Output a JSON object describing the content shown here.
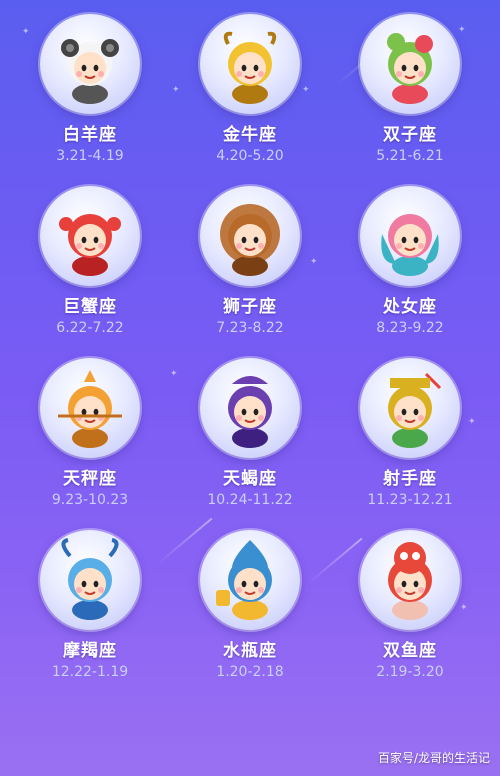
{
  "signs": [
    {
      "key": "aries",
      "name": "白羊座",
      "dates": "3.21-4.19",
      "icon": "aries-mascot-icon",
      "color": "#f5f5f5",
      "accent": "#555555"
    },
    {
      "key": "taurus",
      "name": "金牛座",
      "dates": "4.20-5.20",
      "icon": "taurus-mascot-icon",
      "color": "#f2c230",
      "accent": "#b07a10"
    },
    {
      "key": "gemini",
      "name": "双子座",
      "dates": "5.21-6.21",
      "icon": "gemini-mascot-icon",
      "color": "#7cc24a",
      "accent": "#e84a5a"
    },
    {
      "key": "cancer",
      "name": "巨蟹座",
      "dates": "6.22-7.22",
      "icon": "cancer-mascot-icon",
      "color": "#e8403a",
      "accent": "#b82222"
    },
    {
      "key": "leo",
      "name": "狮子座",
      "dates": "7.23-8.22",
      "icon": "leo-mascot-icon",
      "color": "#b86a2a",
      "accent": "#7a3f12"
    },
    {
      "key": "virgo",
      "name": "处女座",
      "dates": "8.23-9.22",
      "icon": "virgo-mascot-icon",
      "color": "#f07aa0",
      "accent": "#3bb3c4"
    },
    {
      "key": "libra",
      "name": "天秤座",
      "dates": "9.23-10.23",
      "icon": "libra-mascot-icon",
      "color": "#f3a133",
      "accent": "#c0701a"
    },
    {
      "key": "scorpio",
      "name": "天蝎座",
      "dates": "10.24-11.22",
      "icon": "scorpio-mascot-icon",
      "color": "#6a3fb0",
      "accent": "#3d2080"
    },
    {
      "key": "sagittarius",
      "name": "射手座",
      "dates": "11.23-12.21",
      "icon": "sagittarius-mascot-icon",
      "color": "#d8b020",
      "accent": "#4aa84a"
    },
    {
      "key": "capricorn",
      "name": "摩羯座",
      "dates": "12.22-1.19",
      "icon": "capricorn-mascot-icon",
      "color": "#5aaee8",
      "accent": "#2a6ab8"
    },
    {
      "key": "aquarius",
      "name": "水瓶座",
      "dates": "1.20-2.18",
      "icon": "aquarius-mascot-icon",
      "color": "#3a8fd0",
      "accent": "#f2b830"
    },
    {
      "key": "pisces",
      "name": "双鱼座",
      "dates": "2.19-3.20",
      "icon": "pisces-mascot-icon",
      "color": "#e8483a",
      "accent": "#f2c0b0"
    }
  ],
  "watermark": "百家号/龙哥的生活记"
}
